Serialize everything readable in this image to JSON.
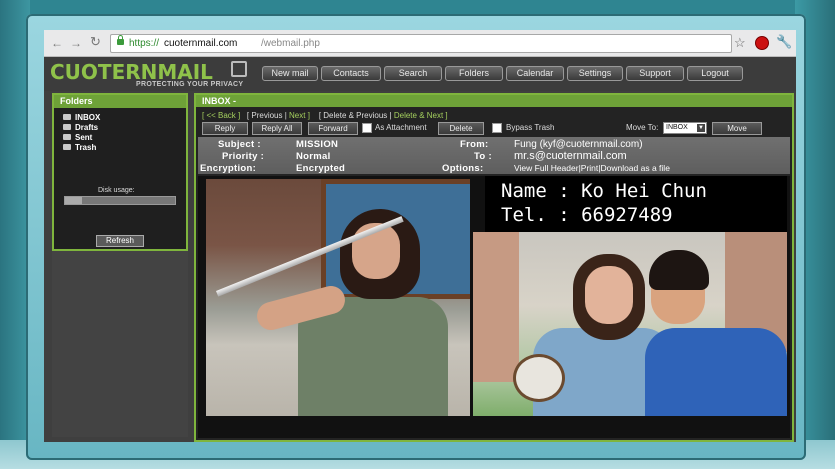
{
  "colors": {
    "accent": "#7fb53d",
    "brand": "#8fc24a",
    "panel": "#232323"
  },
  "browser": {
    "back_icon": "arrow-left-icon",
    "forward_icon": "arrow-right-icon",
    "reload_icon": "reload-icon",
    "url_protocol": "https://",
    "url_host": "cuoternmail.com",
    "url_path": "/webmail.php",
    "bookmark_icon": "star-icon",
    "extension_icon": "stop-icon",
    "settings_icon": "wrench-icon"
  },
  "app": {
    "logo": "CUOTERNMAIL",
    "tagline": "PROTECTING YOUR PRIVACY",
    "menu": [
      "New mail",
      "Contacts",
      "Search",
      "Folders",
      "Calendar",
      "Settings",
      "Support",
      "Logout"
    ]
  },
  "folders": {
    "title": "Folders",
    "items": [
      "INBOX",
      "Drafts",
      "Sent",
      "Trash"
    ],
    "disk_usage_label": "Disk usage:",
    "disk_usage_fraction": 0.15,
    "refresh_label": "Refresh"
  },
  "inbox": {
    "title": "INBOX -",
    "nav": {
      "back": "[ << Back ]",
      "previous": "[ Previous |",
      "next": "Next ]",
      "delete_previous": "[ Delete & Previous |",
      "delete_next": "Delete & Next ]"
    },
    "actions": {
      "reply": "Reply",
      "reply_all": "Reply All",
      "forward": "Forward",
      "as_attachment": "As Attachment",
      "delete": "Delete",
      "bypass_trash": "Bypass Trash",
      "move_to_label": "Move To:",
      "move_to_value": "INBOX",
      "move": "Move"
    },
    "meta": {
      "subject_label": "Subject :",
      "subject_value": "MISSION",
      "priority_label": "Priority :",
      "priority_value": "Normal",
      "encryption_label": "Encryption:",
      "encryption_value": "Encrypted",
      "from_label": "From:",
      "from_value": "Fung (kyf@cuoternmail.com)",
      "to_label": "To :",
      "to_value": "mr.s@cuoternmail.com",
      "options_label": "Options:",
      "options_value": "View Full Header|Print|Download as a file"
    },
    "contact": {
      "name_line": "Name : Ko Hei Chun",
      "tel_line": "Tel. : 66927489"
    }
  }
}
